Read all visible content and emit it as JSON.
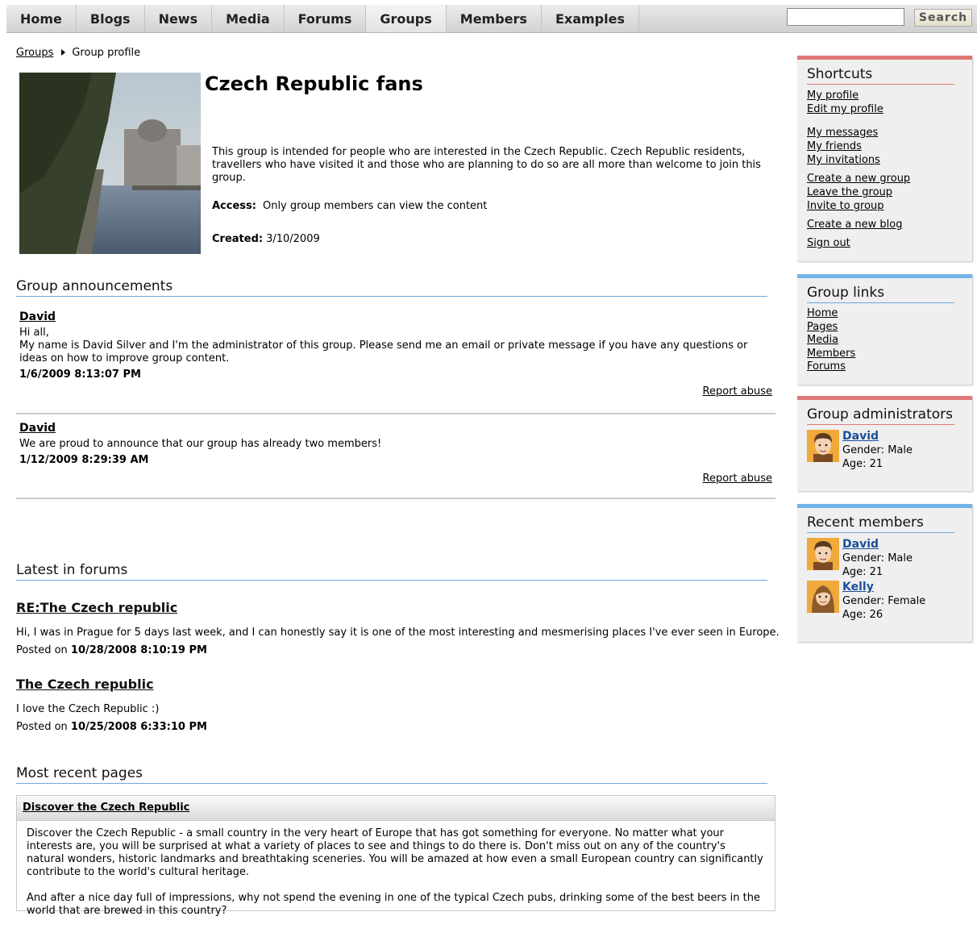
{
  "nav": {
    "items": [
      "Home",
      "Blogs",
      "News",
      "Media",
      "Forums",
      "Groups",
      "Members",
      "Examples"
    ],
    "active": "Groups",
    "search_placeholder": "",
    "search_label": "Search"
  },
  "breadcrumb": {
    "parent": "Groups",
    "current": "Group profile"
  },
  "group": {
    "title": "Czech Republic fans",
    "description": "This group is intended for people who are interested in the Czech Republic. Czech Republic residents, travellers who have visited it and those who are planning to do so are all more than welcome to join this group.",
    "access_label": "Access:",
    "access_value": "Only group members can view the content",
    "created_label": "Created:",
    "created_value": "3/10/2009"
  },
  "announcements": {
    "title": "Group announcements",
    "report_label": "Report abuse",
    "items": [
      {
        "author": "David",
        "text_line1": "Hi all,",
        "text_line2": "My name is David Silver and I'm the administrator of this group. Please send me an email or private message if you have any questions or ideas on how to improve group content.",
        "date": "1/6/2009 8:13:07 PM"
      },
      {
        "author": "David",
        "text_line1": "We are proud to announce that our group has already two members!",
        "date": "1/12/2009 8:29:39 AM"
      }
    ]
  },
  "forums": {
    "title": "Latest in forums",
    "posted_label": "Posted on",
    "items": [
      {
        "title": "RE:The Czech republic",
        "text": "Hi, I was in Prague for 5 days last week, and I can honestly say it is one of the most interesting and mesmerising places I've ever seen in Europe.",
        "date": "10/28/2008 8:10:19 PM"
      },
      {
        "title": "The Czech republic",
        "text": "I love the Czech Republic :)",
        "date": "10/25/2008 6:33:10 PM"
      }
    ]
  },
  "pages": {
    "title": "Most recent pages",
    "item_title": "Discover the Czech Republic",
    "para1": "Discover the Czech Republic - a small country in the very heart of Europe that has got something for everyone. No matter what your interests are, you will be surprised at what a variety of places to see and things to do there is. Don't miss out on any of the country's natural wonders, historic landmarks and breathtaking sceneries. You will be amazed at how even a small European country can significantly contribute to the world's cultural heritage.",
    "para2": "And after a nice day full of impressions, why not spend the evening in one of the typical Czech pubs, drinking some of the best beers in the world that are brewed in this country?"
  },
  "sidebar": {
    "shortcuts": {
      "title": "Shortcuts",
      "links": [
        "My profile",
        "Edit my profile",
        "My messages",
        "My friends",
        "My invitations",
        "Create a new group",
        "Leave the group",
        "Invite to group",
        "Create a new blog",
        "Sign out"
      ]
    },
    "group_links": {
      "title": "Group links",
      "links": [
        "Home",
        "Pages",
        "Media",
        "Members",
        "Forums"
      ]
    },
    "admins": {
      "title": "Group administrators",
      "members": [
        {
          "name": "David",
          "gender": "Gender: Male",
          "age": "Age: 21"
        }
      ]
    },
    "recent": {
      "title": "Recent members",
      "members": [
        {
          "name": "David",
          "gender": "Gender: Male",
          "age": "Age: 21"
        },
        {
          "name": "Kelly",
          "gender": "Gender: Female",
          "age": "Age: 26"
        }
      ]
    }
  },
  "colors": {
    "accent_red": "#e27777",
    "accent_blue": "#6fb4ec",
    "link_blue": "#1a4f9c"
  }
}
